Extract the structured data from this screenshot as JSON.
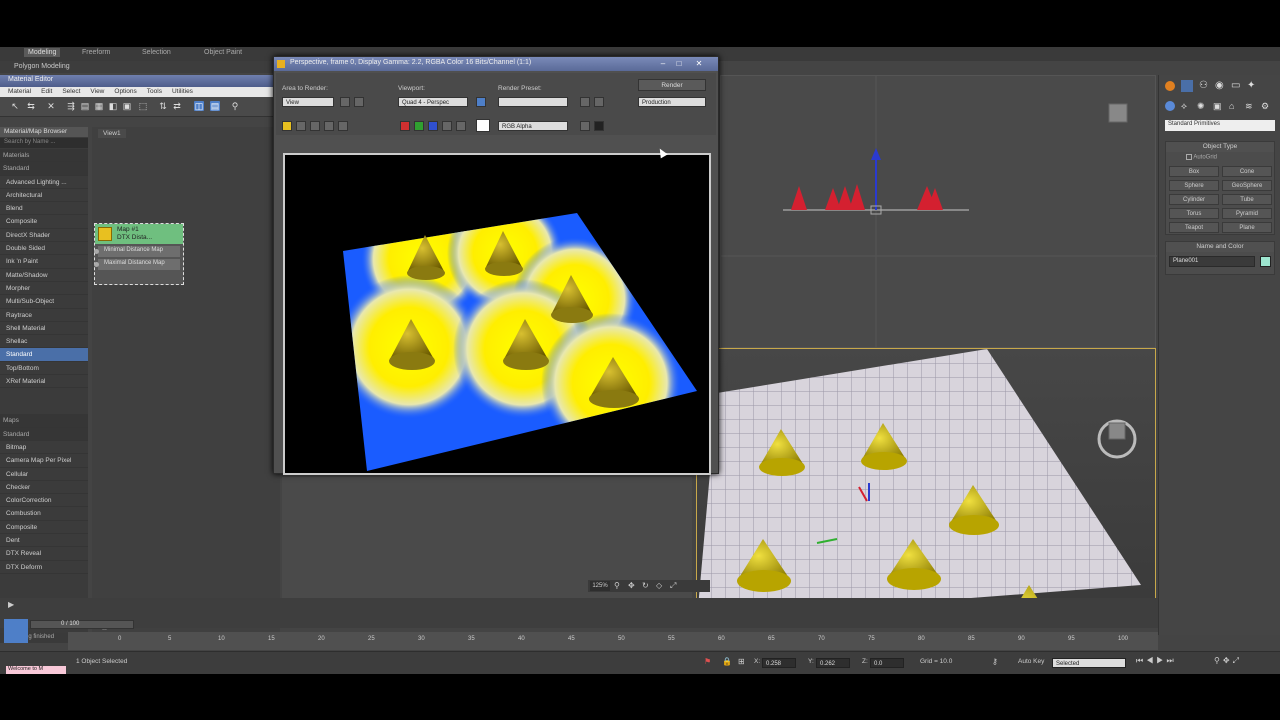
{
  "ribbon": {
    "tabs": [
      "Modeling",
      "Freeform",
      "Selection",
      "Object Paint"
    ],
    "sub_label": "Polygon Modeling"
  },
  "material_editor": {
    "title": "Material Editor",
    "menu": [
      "Material",
      "Edit",
      "Select",
      "View",
      "Options",
      "Tools",
      "Utilities"
    ],
    "browser_title": "Material/Map Browser",
    "browser_search": "Search by Name ...",
    "view_tab": "View1",
    "items": [
      {
        "label": "Materials",
        "group": true
      },
      {
        "label": "Standard",
        "group": true
      },
      {
        "label": "Advanced Lighting ...",
        "group": false
      },
      {
        "label": "Architectural",
        "group": false
      },
      {
        "label": "Blend",
        "group": false
      },
      {
        "label": "Composite",
        "group": false
      },
      {
        "label": "DirectX Shader",
        "group": false
      },
      {
        "label": "Double Sided",
        "group": false
      },
      {
        "label": "Ink 'n Paint",
        "group": false
      },
      {
        "label": "Matte/Shadow",
        "group": false
      },
      {
        "label": "Morpher",
        "group": false
      },
      {
        "label": "Multi/Sub-Object",
        "group": false
      },
      {
        "label": "Raytrace",
        "group": false
      },
      {
        "label": "Shell Material",
        "group": false
      },
      {
        "label": "Shellac",
        "group": false
      },
      {
        "label": "Standard",
        "group": false,
        "selected": true
      },
      {
        "label": "Top/Bottom",
        "group": false
      },
      {
        "label": "XRef Material",
        "group": false
      }
    ],
    "items2": [
      {
        "label": "Maps",
        "group": true
      },
      {
        "label": "Standard",
        "group": true
      },
      {
        "label": "Bitmap",
        "group": false
      },
      {
        "label": "Camera Map Per Pixel",
        "group": false
      },
      {
        "label": "Cellular",
        "group": false
      },
      {
        "label": "Checker",
        "group": false
      },
      {
        "label": "ColorCorrection",
        "group": false
      },
      {
        "label": "Combustion",
        "group": false
      },
      {
        "label": "Composite",
        "group": false
      },
      {
        "label": "Dent",
        "group": false
      },
      {
        "label": "DTX Reveal",
        "group": false
      },
      {
        "label": "DTX Deform",
        "group": false
      }
    ],
    "node": {
      "title_line1": "Map #1",
      "title_line2": "DTX Dista...",
      "slot1": "Minimal Distance Map",
      "slot2": "Maximal Distance Map"
    },
    "status": "Rendering finished"
  },
  "render_window": {
    "title": "Perspective, frame 0, Display Gamma: 2.2, RGBA Color 16 Bits/Channel (1:1)",
    "area_label": "Area to Render:",
    "area_value": "View",
    "viewport_label": "Viewport:",
    "viewport_value": "Quad 4 - Perspec",
    "preset_label": "Render Preset:",
    "preset_value": "",
    "render_button": "Render",
    "production_value": "Production",
    "channel_value": "RGB Alpha",
    "zoom": "125%"
  },
  "command_panel": {
    "dropdown": "Standard Primitives",
    "object_type_title": "Object Type",
    "autogrid": "AutoGrid",
    "buttons": [
      "Box",
      "Cone",
      "Sphere",
      "GeoSphere",
      "Cylinder",
      "Tube",
      "Torus",
      "Pyramid",
      "Teapot",
      "Plane"
    ],
    "name_color_title": "Name and Color",
    "object_name": "Plane001",
    "swatch_color": "#9ee6d0"
  },
  "timeline": {
    "frame": "0 / 100",
    "ticks": [
      "0",
      "5",
      "10",
      "15",
      "20",
      "25",
      "30",
      "35",
      "40",
      "45",
      "50",
      "55",
      "60",
      "65",
      "70",
      "75",
      "80",
      "85",
      "90",
      "95",
      "100"
    ]
  },
  "status_bar": {
    "selection": "1 Object Selected",
    "x": "0.258",
    "y": "0.262",
    "z": "0.0",
    "grid": "Grid = 10.0",
    "autokey": "Auto Key",
    "selected": "Selected",
    "welcome": "Welcome to M"
  },
  "colors": {
    "render_plane_blue": "#1a5cff",
    "cone_yellow": "#e6d000",
    "gizmo_red": "#d42030",
    "selection_gold": "#c8a84a"
  }
}
